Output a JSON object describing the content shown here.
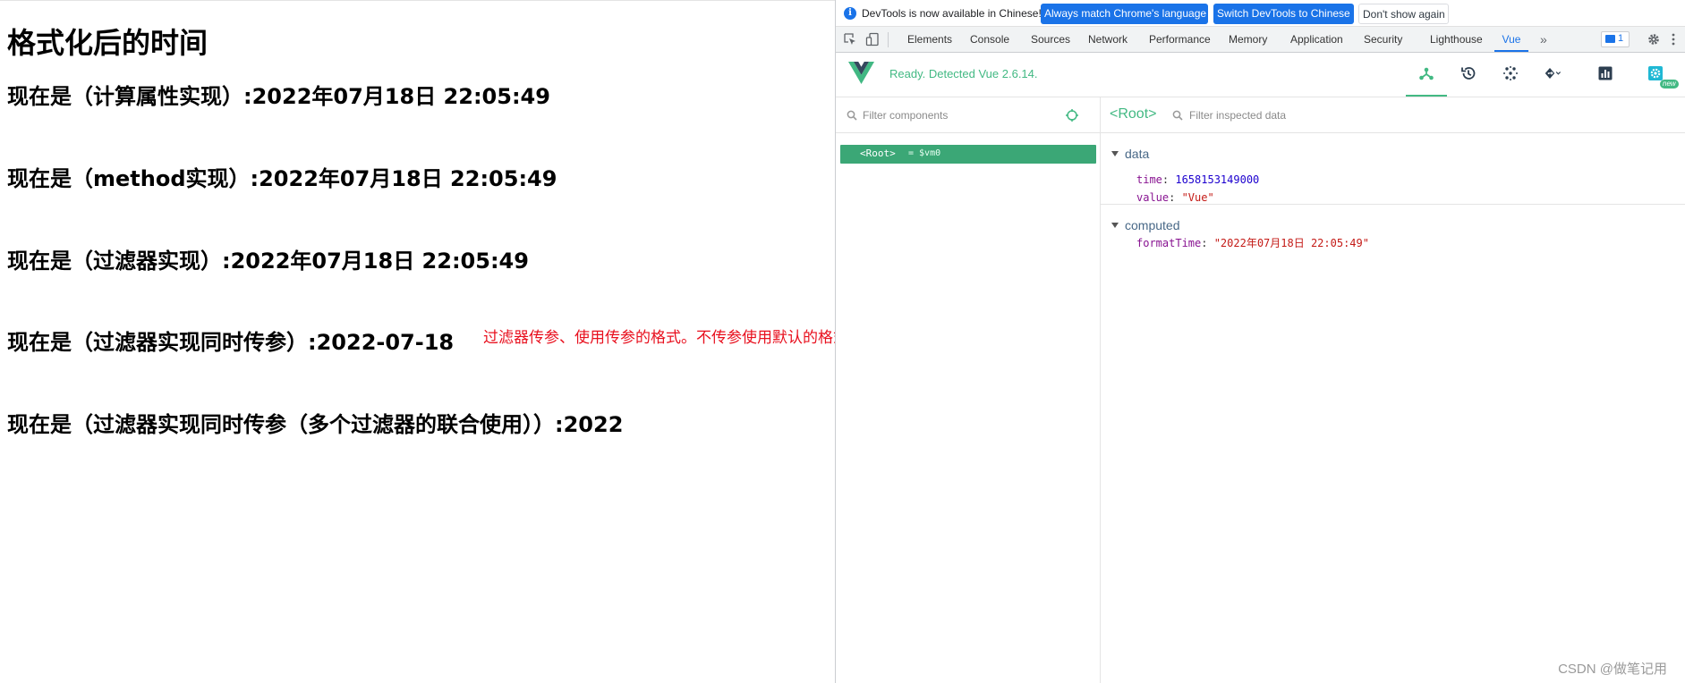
{
  "page": {
    "title": "格式化后的时间",
    "lines": [
      "现在是（计算属性实现）:2022年07月18日 22:05:49",
      "现在是（method实现）:2022年07月18日 22:05:49",
      "现在是（过滤器实现）:2022年07月18日 22:05:49",
      "现在是（过滤器实现同时传参）:2022-07-18",
      "现在是（过滤器实现同时传参（多个过滤器的联合使用））:2022"
    ],
    "note": "过滤器传参、使用传参的格式。不传参使用默认的格式",
    "note_color": "#e8101e"
  },
  "devtools": {
    "infobar": {
      "icon": "info-icon",
      "message": "DevTools is now available in Chinese!",
      "btn_match": "Always match Chrome's language",
      "btn_switch": "Switch DevTools to Chinese",
      "btn_dont_show": "Don't show again"
    },
    "tabs": {
      "elements": "Elements",
      "console": "Console",
      "sources": "Sources",
      "network": "Network",
      "performance": "Performance",
      "memory": "Memory",
      "application": "Application",
      "security": "Security",
      "lighthouse": "Lighthouse",
      "vue": "Vue",
      "active": "Vue",
      "more": "»"
    },
    "issues_count": "1",
    "accent_color": "#1a73e8"
  },
  "vue": {
    "status": "Ready. Detected Vue 2.6.14.",
    "accent_color": "#42b983",
    "tools": [
      "components-icon",
      "history-icon",
      "vuex-icon",
      "routing-icon",
      "performance-icon",
      "settings-icon"
    ],
    "active_tool": "components",
    "new_badge": "new",
    "components": {
      "filter_placeholder": "Filter components",
      "root_label": "<Root>",
      "root_vm": "= $vm0"
    },
    "inspector": {
      "name": "<Root>",
      "filter_placeholder": "Filter inspected data",
      "data_title": "data",
      "data": {
        "time_key": "time",
        "time_value": "1658153149000",
        "value_key": "value",
        "value_value": "\"Vue\""
      },
      "computed_title": "computed",
      "computed": {
        "formattime_key": "formatTime",
        "formattime_value": "\"2022年07月18日 22:05:49\""
      }
    }
  },
  "watermark": "CSDN @做笔记用"
}
